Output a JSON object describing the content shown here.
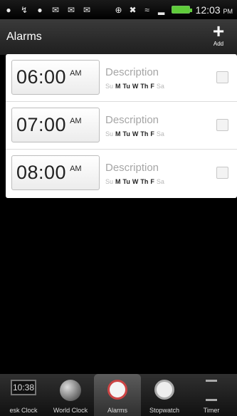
{
  "status_bar": {
    "time": "12:03",
    "ampm": "PM",
    "icons": [
      "usb-icon",
      "notification-icon",
      "mail-icon",
      "mail-icon",
      "message-icon",
      "gps-icon",
      "sync-icon",
      "wifi-icon",
      "signal-icon",
      "battery-icon"
    ]
  },
  "header": {
    "title": "Alarms",
    "add_label": "Add"
  },
  "alarms": [
    {
      "time": "06:00",
      "ampm": "AM",
      "description": "Description",
      "days": [
        {
          "label": "Su",
          "on": false
        },
        {
          "label": "M",
          "on": true
        },
        {
          "label": "Tu",
          "on": true
        },
        {
          "label": "W",
          "on": true
        },
        {
          "label": "Th",
          "on": true
        },
        {
          "label": "F",
          "on": true
        },
        {
          "label": "Sa",
          "on": false
        }
      ],
      "enabled": false
    },
    {
      "time": "07:00",
      "ampm": "AM",
      "description": "Description",
      "days": [
        {
          "label": "Su",
          "on": false
        },
        {
          "label": "M",
          "on": true
        },
        {
          "label": "Tu",
          "on": true
        },
        {
          "label": "W",
          "on": true
        },
        {
          "label": "Th",
          "on": true
        },
        {
          "label": "F",
          "on": true
        },
        {
          "label": "Sa",
          "on": false
        }
      ],
      "enabled": false
    },
    {
      "time": "08:00",
      "ampm": "AM",
      "description": "Description",
      "days": [
        {
          "label": "Su",
          "on": false
        },
        {
          "label": "M",
          "on": true
        },
        {
          "label": "Tu",
          "on": true
        },
        {
          "label": "W",
          "on": true
        },
        {
          "label": "Th",
          "on": true
        },
        {
          "label": "F",
          "on": true
        },
        {
          "label": "Sa",
          "on": false
        }
      ],
      "enabled": false
    }
  ],
  "tabs": [
    {
      "label": "esk Clock",
      "icon": "desk-clock-icon",
      "icon_text": "10:38"
    },
    {
      "label": "World Clock",
      "icon": "globe-icon"
    },
    {
      "label": "Alarms",
      "icon": "alarm-clock-icon",
      "active": true
    },
    {
      "label": "Stopwatch",
      "icon": "stopwatch-icon"
    },
    {
      "label": "Timer",
      "icon": "hourglass-icon"
    }
  ]
}
